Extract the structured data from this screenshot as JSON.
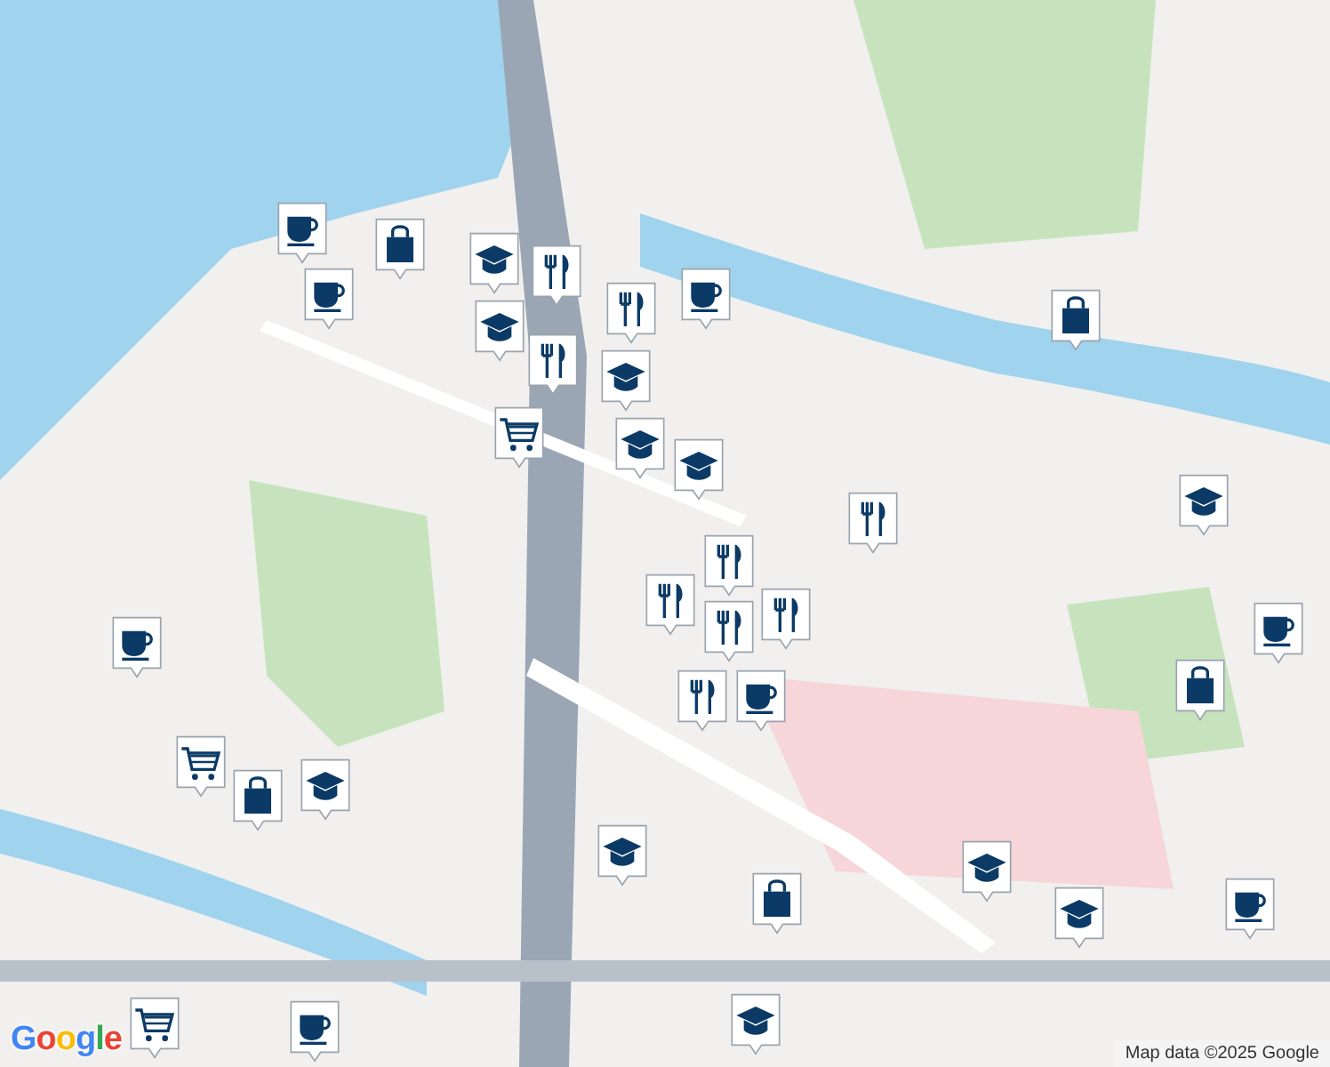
{
  "map": {
    "markers": [
      {
        "kind": "coffee"
      },
      {
        "kind": "bag"
      },
      {
        "kind": "coffee"
      },
      {
        "kind": "school"
      },
      {
        "kind": "food"
      },
      {
        "kind": "school"
      },
      {
        "kind": "food"
      },
      {
        "kind": "coffee"
      },
      {
        "kind": "food"
      },
      {
        "kind": "school"
      },
      {
        "kind": "cart"
      },
      {
        "kind": "school"
      },
      {
        "kind": "school"
      },
      {
        "kind": "food"
      },
      {
        "kind": "school"
      },
      {
        "kind": "bag"
      },
      {
        "kind": "food"
      },
      {
        "kind": "food"
      },
      {
        "kind": "food"
      },
      {
        "kind": "food"
      },
      {
        "kind": "food"
      },
      {
        "kind": "coffee"
      },
      {
        "kind": "coffee"
      },
      {
        "kind": "cart"
      },
      {
        "kind": "bag"
      },
      {
        "kind": "school"
      },
      {
        "kind": "school"
      },
      {
        "kind": "bag"
      },
      {
        "kind": "school"
      },
      {
        "kind": "school"
      },
      {
        "kind": "coffee"
      },
      {
        "kind": "bag"
      },
      {
        "kind": "coffee"
      },
      {
        "kind": "cart"
      },
      {
        "kind": "coffee"
      },
      {
        "kind": "school"
      }
    ]
  },
  "attribution": {
    "logo": "Google",
    "text": "Map data ©2025 Google"
  }
}
